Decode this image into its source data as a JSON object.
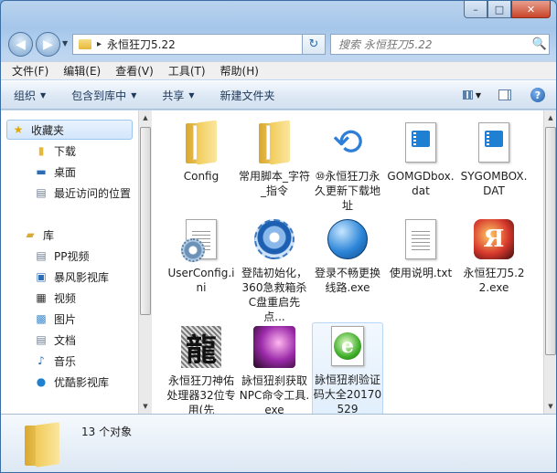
{
  "window": {
    "address_path": "永恒狂刀5.22",
    "search_placeholder": "搜索 永恒狂刀5.22",
    "caption": {
      "minimize": "–",
      "maximize": "□",
      "close": "✕"
    }
  },
  "menu": [
    "文件(F)",
    "编辑(E)",
    "查看(V)",
    "工具(T)",
    "帮助(H)"
  ],
  "toolbar": {
    "organize": "组织",
    "include_library": "包含到库中",
    "share": "共享",
    "new_folder": "新建文件夹"
  },
  "nav": {
    "favorites": "收藏夹",
    "download": "下载",
    "desktop": "桌面",
    "recent": "最近访问的位置",
    "library": "库",
    "pp_video": "PP视频",
    "storm": "暴风影视库",
    "video": "视频",
    "pictures": "图片",
    "documents": "文档",
    "music": "音乐",
    "youku": "优酷影视库"
  },
  "files": [
    {
      "name": "Config",
      "icon": "folder-icon"
    },
    {
      "name": "常用脚本_字符_指令",
      "icon": "folder-icon"
    },
    {
      "name": "⑩永恒狂刀永久更新下载地址",
      "icon": "shortcut-arrows-icon"
    },
    {
      "name": "GOMGDbox.dat",
      "icon": "dat-file-icon"
    },
    {
      "name": "SYGOMBOX.DAT",
      "icon": "dat-file-icon"
    },
    {
      "name": "UserConfig.ini",
      "icon": "ini-file-icon"
    },
    {
      "name": "登陆初始化，360急救箱杀C盘重启先点...",
      "icon": "swirl-app-icon"
    },
    {
      "name": "登录不畅更换线路.exe",
      "icon": "globe-app-icon"
    },
    {
      "name": "使用说明.txt",
      "icon": "txt-file-icon"
    },
    {
      "name": "永恒狂刀5.22.exe",
      "icon": "game-logo-icon"
    },
    {
      "name": "永恒狂刀神佑处理器32位专用(先",
      "icon": "dragon-app-icon"
    },
    {
      "name": "詠恒狃刹获取NPC命令工具.exe",
      "icon": "game-app-icon"
    },
    {
      "name": "詠恒狃刹验证码大全20170529",
      "icon": "ie-html-icon"
    }
  ],
  "status": {
    "count": "13 个对象"
  }
}
